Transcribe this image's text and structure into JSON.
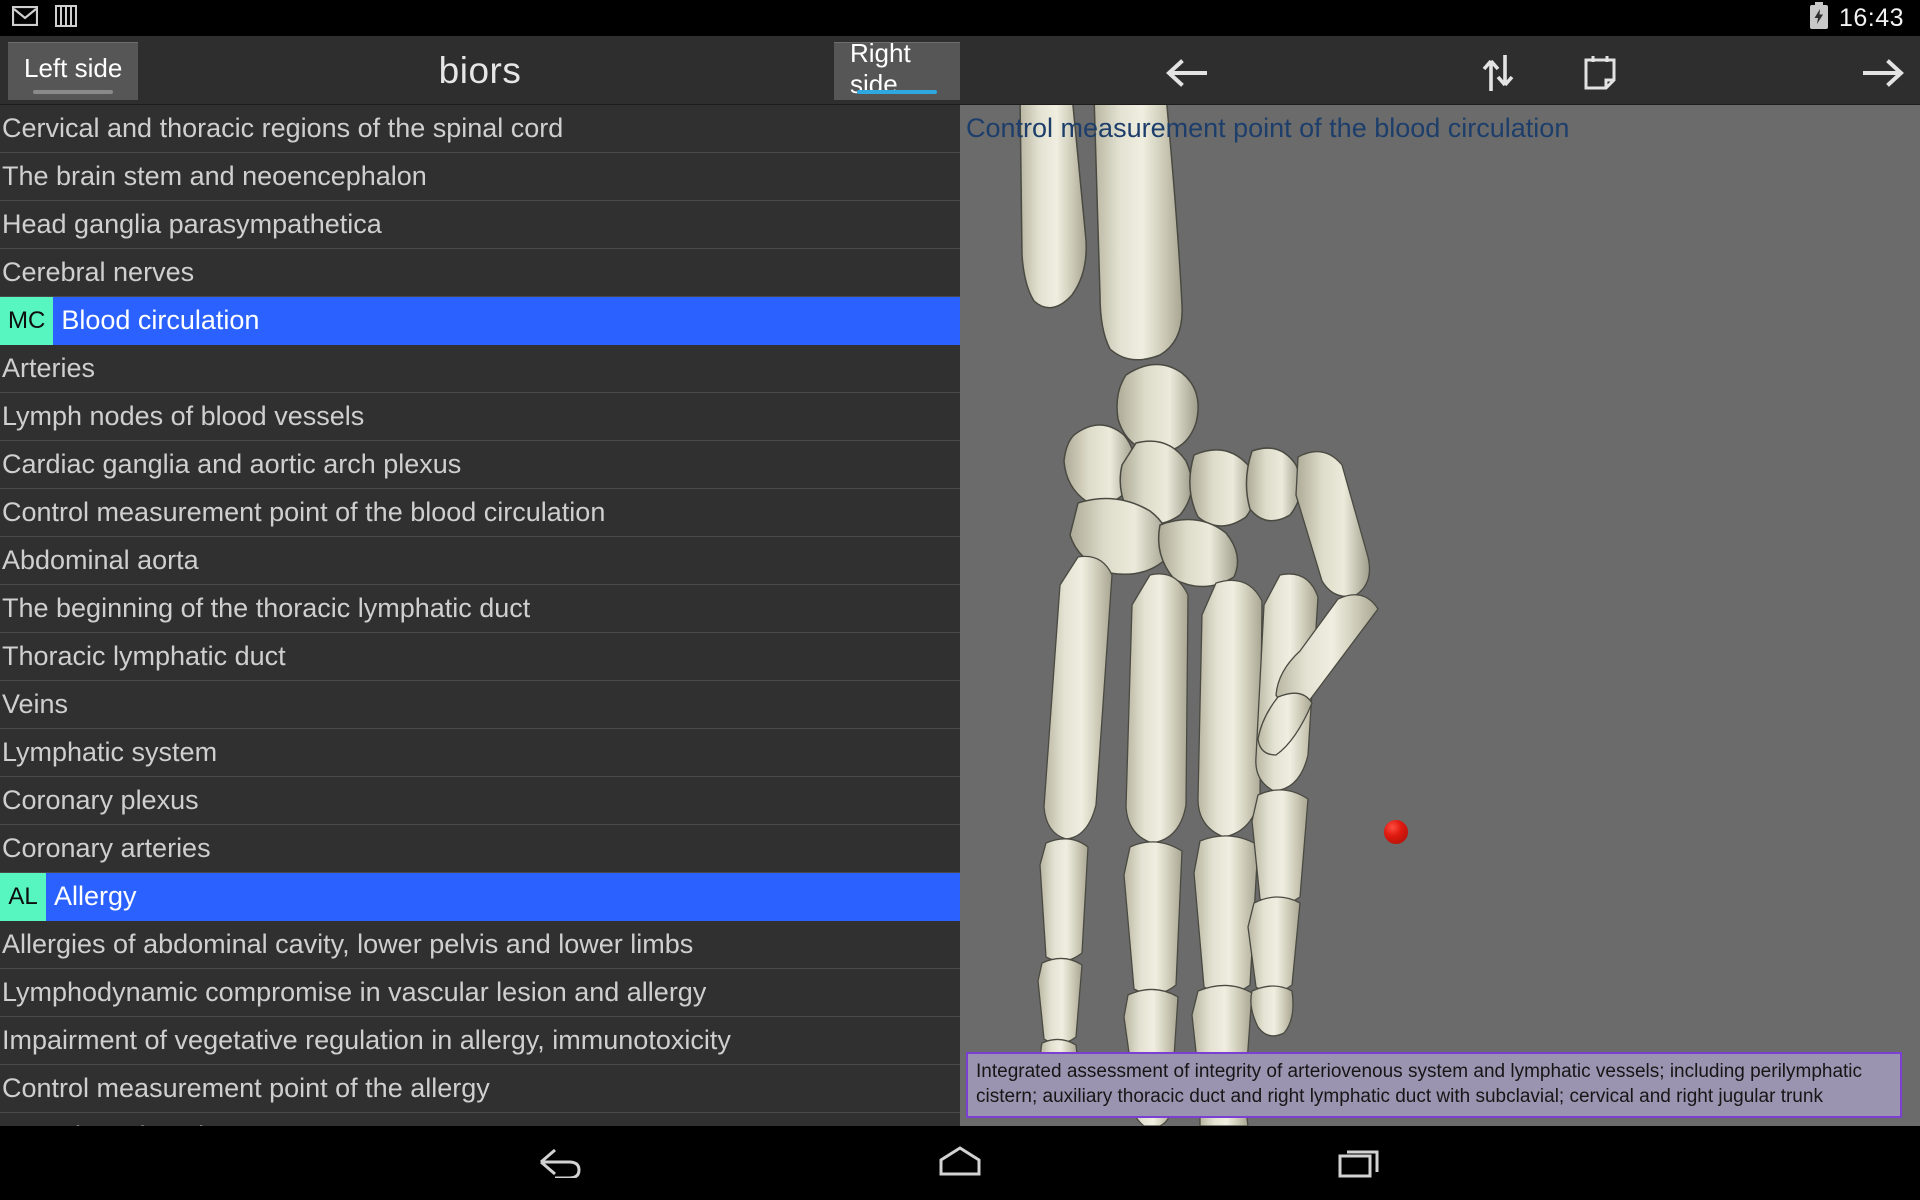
{
  "status_bar": {
    "notification_icons": [
      "mail-icon",
      "book-icon"
    ],
    "battery_icon": "battery-charging-icon",
    "clock": "16:43"
  },
  "action_bar": {
    "app_title": "biors",
    "tabs": [
      {
        "label": "Left side",
        "selected": false
      },
      {
        "label": "Right side",
        "selected": true
      }
    ],
    "icons": [
      {
        "name": "arrow-back-icon",
        "label": "Back"
      },
      {
        "name": "swap-vertical-icon",
        "label": "Swap"
      },
      {
        "name": "note-icon",
        "label": "Note"
      },
      {
        "name": "arrow-forward-icon",
        "label": "Forward"
      }
    ]
  },
  "list_panel": {
    "rows": [
      {
        "badge": "",
        "label": "Cervical and thoracic regions of the spinal cord",
        "selected": false
      },
      {
        "badge": "",
        "label": "The brain stem and neoencephalon",
        "selected": false
      },
      {
        "badge": "",
        "label": "Head ganglia parasympathetica",
        "selected": false
      },
      {
        "badge": "",
        "label": "Cerebral nerves",
        "selected": false
      },
      {
        "badge": "MC",
        "label": "Blood circulation",
        "selected": true
      },
      {
        "badge": "",
        "label": "Arteries",
        "selected": false
      },
      {
        "badge": "",
        "label": "Lymph nodes of blood vessels",
        "selected": false
      },
      {
        "badge": "",
        "label": "Cardiac ganglia and aortic arch plexus",
        "selected": false
      },
      {
        "badge": "",
        "label": "Control measurement point of the blood circulation",
        "selected": false
      },
      {
        "badge": "",
        "label": "Abdominal aorta",
        "selected": false
      },
      {
        "badge": "",
        "label": "The beginning of the thoracic lymphatic duct",
        "selected": false
      },
      {
        "badge": "",
        "label": "Thoracic lymphatic duct",
        "selected": false
      },
      {
        "badge": "",
        "label": "Veins",
        "selected": false
      },
      {
        "badge": "",
        "label": "Lymphatic system",
        "selected": false
      },
      {
        "badge": "",
        "label": "Coronary plexus",
        "selected": false
      },
      {
        "badge": "",
        "label": "Coronary arteries",
        "selected": false
      },
      {
        "badge": "AL",
        "label": "Allergy",
        "selected": true
      },
      {
        "badge": "",
        "label": "Allergies of abdominal cavity, lower pelvis and lower limbs",
        "selected": false
      },
      {
        "badge": "",
        "label": "Lymphodynamic compromise in vascular lesion and allergy",
        "selected": false
      },
      {
        "badge": "",
        "label": "Impairment of vegetative regulation in allergy, immunotoxicity",
        "selected": false
      },
      {
        "badge": "",
        "label": "Control measurement point of the allergy",
        "selected": false
      },
      {
        "badge": "",
        "label": "Vascular sclerosis",
        "selected": false
      }
    ]
  },
  "viewport": {
    "title": "Control measurement point of the blood circulation",
    "model": "hand-skeleton-3d",
    "marker": {
      "name": "measurement-point-marker",
      "color": "#d61c10"
    },
    "description": "Integrated assessment of integrity of arteriovenous system and lymphatic vessels; including perilymphatic cistern; auxiliary thoracic duct and right lymphatic duct with subclavial; cervical and right jugular trunk"
  },
  "nav_bar": {
    "buttons": [
      {
        "name": "nav-back-button",
        "label": "Back"
      },
      {
        "name": "nav-home-button",
        "label": "Home"
      },
      {
        "name": "nav-recents-button",
        "label": "Recents"
      }
    ]
  },
  "colors": {
    "selected_row": "#2b62ff",
    "badge_bg": "#57f5c0",
    "tab_accent": "#2fa8e0",
    "viewport_bg": "#6b6b6b",
    "desc_border": "#7b3fd4",
    "desc_bg": "#9a94b0",
    "title_text": "#1d3e6b"
  }
}
